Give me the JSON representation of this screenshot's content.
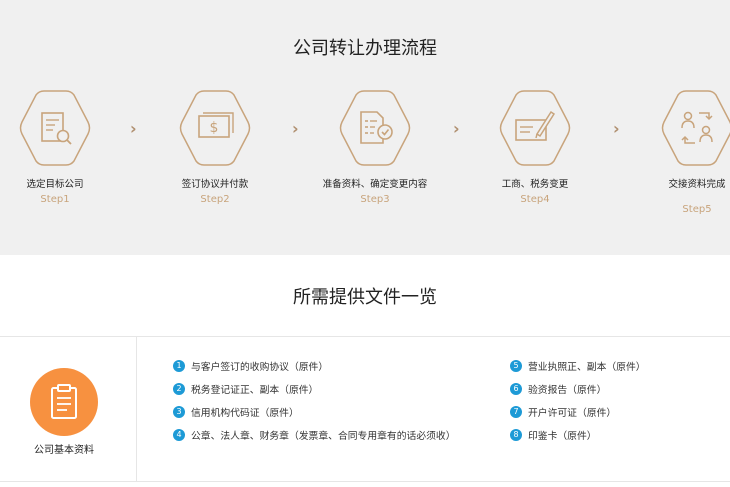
{
  "process": {
    "title": "公司转让办理流程",
    "steps": [
      {
        "label": "选定目标公司",
        "step": "Step1",
        "icon": "document-search-icon"
      },
      {
        "label": "签订协议并付款",
        "step": "Step2",
        "icon": "money-payment-icon"
      },
      {
        "label": "准备资料、确定变更内容",
        "step": "Step3",
        "icon": "checklist-icon"
      },
      {
        "label": "工商、税务变更",
        "step": "Step4",
        "icon": "pen-edit-icon"
      },
      {
        "label": "交接资料完成",
        "step": "Step5",
        "icon": "handover-exchange-icon"
      }
    ],
    "arrow": "›"
  },
  "docs": {
    "title": "所需提供文件一览",
    "category": {
      "label": "公司基本资料",
      "icon": "clipboard-icon"
    },
    "items": [
      {
        "num": "1",
        "text": "与客户签订的收购协议（原件）"
      },
      {
        "num": "2",
        "text": "税务登记证正、副本（原件）"
      },
      {
        "num": "3",
        "text": "信用机构代码证（原件）"
      },
      {
        "num": "4",
        "text": "公章、法人章、财务章（发票章、合同专用章有的话必须收）"
      },
      {
        "num": "5",
        "text": "营业执照正、副本（原件）"
      },
      {
        "num": "6",
        "text": "验资报告（原件）"
      },
      {
        "num": "7",
        "text": "开户许可证（原件）"
      },
      {
        "num": "8",
        "text": "印鉴卡（原件）"
      }
    ]
  },
  "colors": {
    "accent": "#c8a47c",
    "orange": "#f79140",
    "blue": "#1d9ad6",
    "band": "#f0f0f0"
  }
}
